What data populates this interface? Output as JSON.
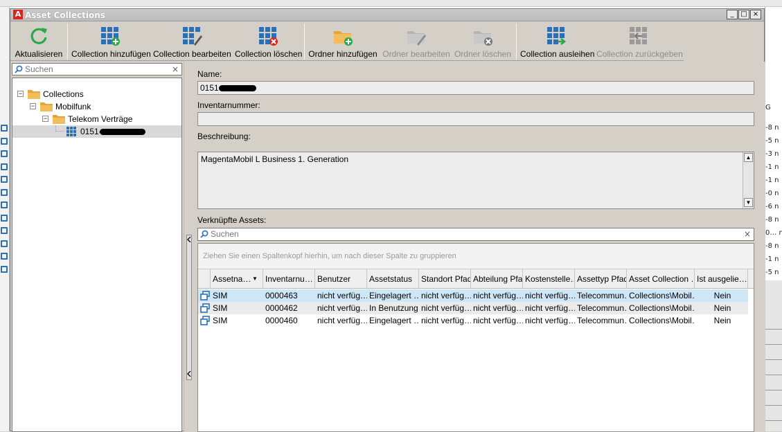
{
  "window": {
    "title": "Asset Collections",
    "app_icon_letter": "A",
    "minimize": "_",
    "maximize": "□",
    "close": "×"
  },
  "toolbar": {
    "buttons": [
      {
        "label": "Aktualisieren",
        "icon": "refresh-icon",
        "enabled": true
      },
      {
        "label": "Collection hinzufügen",
        "icon": "grid-add-icon",
        "enabled": true
      },
      {
        "label": "Collection bearbeiten",
        "icon": "grid-edit-icon",
        "enabled": true
      },
      {
        "label": "Collection löschen",
        "icon": "grid-delete-icon",
        "enabled": true
      },
      {
        "label": "Ordner hinzufügen",
        "icon": "folder-add-icon",
        "enabled": true
      },
      {
        "label": "Ordner bearbeiten",
        "icon": "folder-edit-icon",
        "enabled": false
      },
      {
        "label": "Ordner löschen",
        "icon": "folder-delete-icon",
        "enabled": false
      },
      {
        "label": "Collection ausleihen",
        "icon": "grid-lend-icon",
        "enabled": true
      },
      {
        "label": "Collection zurückgeben",
        "icon": "grid-return-icon",
        "enabled": false
      }
    ]
  },
  "left": {
    "search_placeholder": "Suchen",
    "clear": "×",
    "tree": [
      {
        "label": "Collections",
        "expander": "−"
      },
      {
        "label": "Mobilfunk",
        "expander": "−"
      },
      {
        "label": "Telekom Verträge",
        "expander": "−"
      },
      {
        "label": "0151-"
      }
    ]
  },
  "detail": {
    "name_label": "Name:",
    "name_value": "0151-",
    "inventory_label": "Inventarnummer:",
    "inventory_value": "",
    "description_label": "Beschreibung:",
    "description_value": "MagentaMobil L Business 1. Generation",
    "linked_label": "Verknüpfte Assets:",
    "asset_search_placeholder": "Suchen",
    "clear": "×"
  },
  "grid": {
    "group_hint": "Ziehen Sie einen Spaltenkopf hierhin, um nach dieser Spalte zu gruppieren",
    "columns": [
      "Assetna…",
      "Inventarnu…",
      "Benutzer",
      "Assetstatus",
      "Standort Pfad",
      "Abteilung Pfad",
      "Kostenstelle…",
      "Assettyp Pfad",
      "Asset Collection …",
      "Ist ausgelie…"
    ],
    "rows": [
      [
        "SIM",
        "0000463",
        "nicht verfüg…",
        "Eingelagert …",
        "nicht verfüg…",
        "nicht verfüg…",
        "nicht verfüg…",
        "Telecommun…",
        "Collections\\Mobil…",
        "Nein"
      ],
      [
        "SIM",
        "0000462",
        "nicht verfüg…",
        "In Benutzung",
        "nicht verfüg…",
        "nicht verfüg…",
        "nicht verfüg…",
        "Telecommun…",
        "Collections\\Mobil…",
        "Nein"
      ],
      [
        "SIM",
        "0000460",
        "nicht verfüg…",
        "Eingelagert …",
        "nicht verfüg…",
        "nicht verfüg…",
        "nicht verfüg…",
        "Telecommun…",
        "Collections\\Mobil…",
        "Nein"
      ]
    ]
  },
  "background": {
    "left_glyph_count": 12,
    "right_header": "G",
    "right_cells": [
      "-8 n",
      "-5 n",
      "-3 n",
      "-1 n",
      "-1 n",
      "-0 n",
      "-6 n",
      "-8 n",
      "0… n",
      "-8 n",
      "-1 n",
      "-5 n"
    ]
  },
  "colors": {
    "accent_blue": "#2a6fb8",
    "accent_green": "#2aa84a",
    "accent_red": "#d9261c",
    "folder": "#e8a43a",
    "selected_row": "#cfe6f7"
  }
}
